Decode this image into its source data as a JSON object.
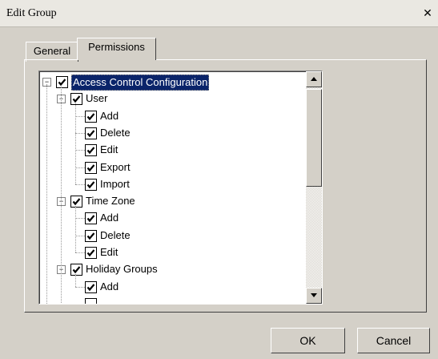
{
  "window": {
    "title": "Edit Group",
    "close_glyph": "✕"
  },
  "tabs": [
    {
      "label": "General"
    },
    {
      "label": "Permissions"
    }
  ],
  "tree": {
    "root": {
      "label": "Access Control Configuration",
      "checked": true,
      "expanded": true
    },
    "groups": [
      {
        "label": "User",
        "checked": true,
        "expanded": true,
        "items": [
          "Add",
          "Delete",
          "Edit",
          "Export",
          "Import"
        ]
      },
      {
        "label": "Time Zone",
        "checked": true,
        "expanded": true,
        "items": [
          "Add",
          "Delete",
          "Edit"
        ]
      },
      {
        "label": "Holiday Groups",
        "checked": true,
        "expanded": true,
        "items": [
          "Add"
        ]
      }
    ]
  },
  "buttons": {
    "ok": "OK",
    "cancel": "Cancel"
  },
  "icons": {
    "expander": "minus-expander-icon",
    "checkbox": "checkmark-icon"
  },
  "colors": {
    "selection": "#0a246a",
    "dialog_bg": "#d4d0c8"
  }
}
